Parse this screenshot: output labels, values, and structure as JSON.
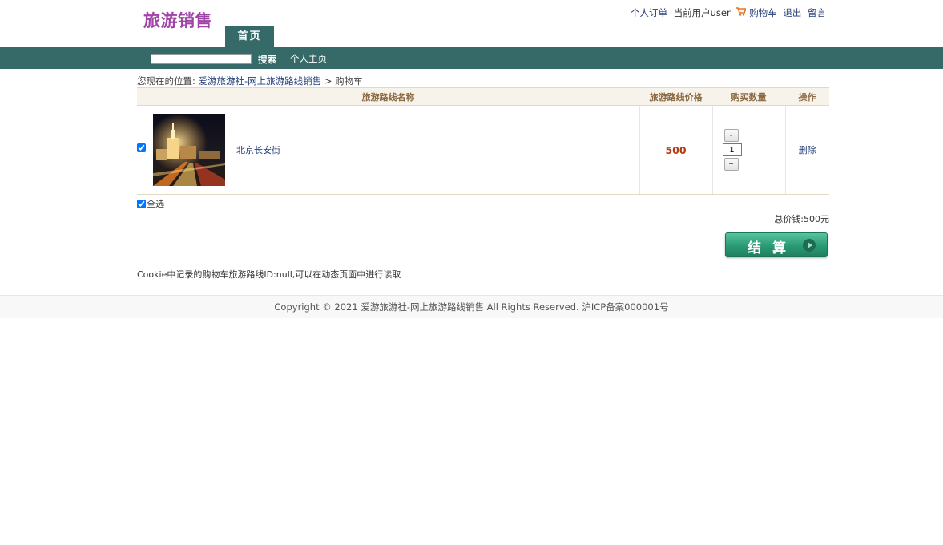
{
  "header": {
    "logo": "旅游销售",
    "links": {
      "orders": "个人订单",
      "current_user": "当前用户user",
      "cart": "购物车",
      "logout": "退出",
      "message": "留言"
    },
    "home_tab": "首页"
  },
  "nav": {
    "search_value": "",
    "search_label": "搜索",
    "profile": "个人主页"
  },
  "breadcrumb": {
    "prefix": "您现在的位置:",
    "site": "爱游旅游社-网上旅游路线销售",
    "separator": ">",
    "current": "购物车"
  },
  "cart": {
    "columns": [
      "旅游路线名称",
      "旅游路线价格",
      "购买数量",
      "操作"
    ],
    "items": [
      {
        "name": "北京长安街",
        "price": "500",
        "qty": "1",
        "minus": "-",
        "plus": "+",
        "delete": "删除",
        "checked": true
      }
    ],
    "select_all": "全选",
    "total": "总价钱:500元",
    "checkout": "结算"
  },
  "cookie_note": "Cookie中记录的购物车旅游路线ID:null,可以在动态页面中进行读取",
  "footer": "Copyright © 2021 爱游旅游社-网上旅游路线销售 All Rights Reserved. 沪ICP备案000001号",
  "icons": {
    "cart": "cart-icon",
    "checkout": "play-icon"
  },
  "colors": {
    "nav": "#356a69",
    "logo": "#a044a8",
    "price": "#b23b14",
    "checkout": "#2a9a73"
  }
}
